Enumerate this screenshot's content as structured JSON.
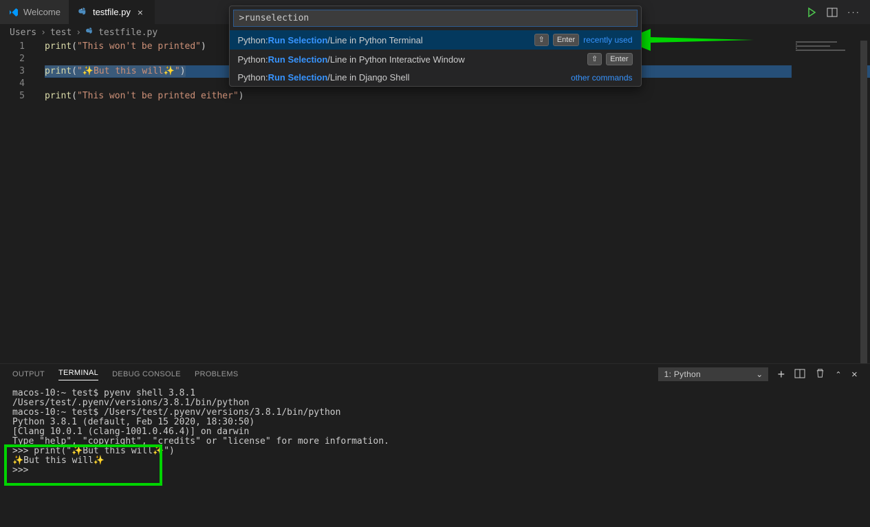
{
  "tabs": [
    {
      "label": "Welcome",
      "icon": "vscode"
    },
    {
      "label": "testfile.py",
      "icon": "python",
      "active": true
    }
  ],
  "breadcrumb": {
    "parts": [
      "Users",
      "test",
      "testfile.py"
    ]
  },
  "editor": {
    "lines": [
      {
        "n": "1",
        "fn": "print",
        "open": "(",
        "str": "\"This won't be printed\"",
        "close": ")",
        "selected": false
      },
      {
        "n": "2",
        "fn": "",
        "open": "",
        "str": "",
        "close": "",
        "selected": false
      },
      {
        "n": "3",
        "fn": "print",
        "open": "(",
        "str": "\"✨But this will✨\"",
        "close": ")",
        "selected": true
      },
      {
        "n": "4",
        "fn": "",
        "open": "",
        "str": "",
        "close": "",
        "selected": false
      },
      {
        "n": "5",
        "fn": "print",
        "open": "(",
        "str": "\"This won't be printed either\"",
        "close": ")",
        "selected": false
      }
    ]
  },
  "palette": {
    "input": ">runselection",
    "rows": [
      {
        "prefix": "Python: ",
        "hl": "Run Selection",
        "suffix": "/Line in Python Terminal",
        "keys": [
          "⇧",
          "Enter"
        ],
        "hint": "recently used",
        "selected": true
      },
      {
        "prefix": "Python: ",
        "hl": "Run Selection",
        "suffix": "/Line in Python Interactive Window",
        "keys": [
          "⇧",
          "Enter"
        ],
        "hint": "",
        "selected": false
      },
      {
        "prefix": "Python: ",
        "hl": "Run Selection",
        "suffix": "/Line in Django Shell",
        "keys": [],
        "hint": "other commands",
        "selected": false
      }
    ]
  },
  "panel": {
    "tabs": [
      "OUTPUT",
      "TERMINAL",
      "DEBUG CONSOLE",
      "PROBLEMS"
    ],
    "activeTab": "TERMINAL",
    "terminalSelect": "1: Python",
    "lines": [
      "macos-10:~ test$ pyenv shell 3.8.1",
      "/Users/test/.pyenv/versions/3.8.1/bin/python",
      "macos-10:~ test$ /Users/test/.pyenv/versions/3.8.1/bin/python",
      "Python 3.8.1 (default, Feb 15 2020, 18:30:50)",
      "[Clang 10.0.1 (clang-1001.0.46.4)] on darwin",
      "Type \"help\", \"copyright\", \"credits\" or \"license\" for more information.",
      ">>> print(\"✨But this will✨\")",
      "✨But this will✨",
      ">>>"
    ]
  }
}
